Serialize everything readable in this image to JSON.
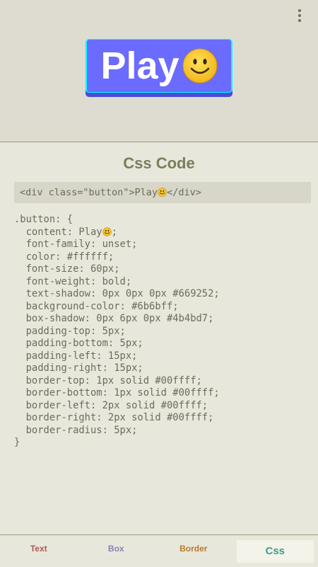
{
  "preview": {
    "button_label": "Play",
    "menu_icon": "more-vert-icon"
  },
  "colors": {
    "button_bg": "#6b6bff",
    "button_shadow": "#4b4bd7",
    "button_border": "#00ffff",
    "title": "#7a7e5a",
    "tab_text": "#b35454",
    "tab_box": "#8a7fb8",
    "tab_border": "#b87a2a",
    "tab_css": "#3aa190"
  },
  "code": {
    "title": "Css Code",
    "html_before": "<div class=\"button\">Play",
    "html_after": "</div>",
    "selector_open": ".button: {",
    "content_before": "  content: Play",
    "content_after": ";",
    "lines": [
      "  font-family: unset;",
      "  color: #ffffff;",
      "  font-size: 60px;",
      "  font-weight: bold;",
      "  text-shadow: 0px 0px 0px #669252;",
      "  background-color: #6b6bff;",
      "  box-shadow: 0px 6px 0px #4b4bd7;",
      "  padding-top: 5px;",
      "  padding-bottom: 5px;",
      "  padding-left: 15px;",
      "  padding-right: 15px;",
      "  border-top: 1px solid #00ffff;",
      "  border-bottom: 1px solid #00ffff;",
      "  border-left: 2px solid #00ffff;",
      "  border-right: 2px solid #00ffff;",
      "  border-radius: 5px;"
    ],
    "selector_close": "}"
  },
  "tabs": {
    "text": "Text",
    "box": "Box",
    "border": "Border",
    "css": "Css",
    "selected": "Css"
  }
}
